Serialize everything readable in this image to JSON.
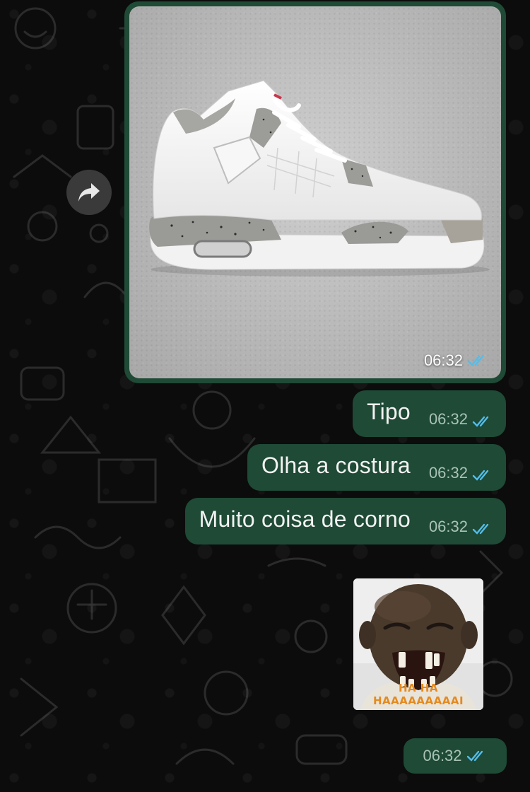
{
  "chat": {
    "image_message": {
      "time": "06:32",
      "status": "read",
      "forward_icon": "forward-arrow-icon"
    },
    "text_messages": [
      {
        "text": "Tipo",
        "time": "06:32",
        "status": "read"
      },
      {
        "text": "Olha a costura",
        "time": "06:32",
        "status": "read"
      },
      {
        "text": "Muito coisa de corno",
        "time": "06:32",
        "status": "read"
      }
    ],
    "sticker_message": {
      "caption": "HA HA HAAAAAAAAAI",
      "time": "06:32",
      "status": "read"
    }
  },
  "colors": {
    "bubble_outgoing": "#1e4a36",
    "tick_read": "#53bdeb",
    "background": "#0b0b0b"
  }
}
